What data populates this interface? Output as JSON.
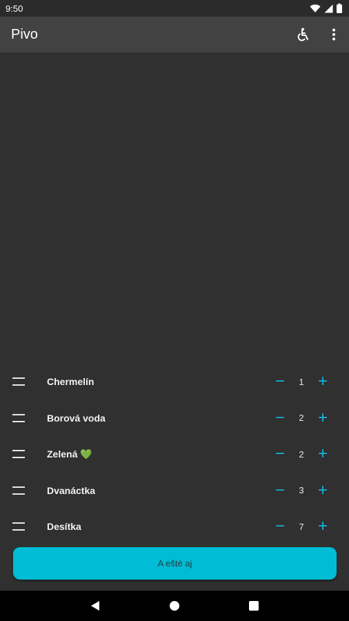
{
  "status_bar": {
    "time": "9:50"
  },
  "app_bar": {
    "title": "Pivo"
  },
  "beers": [
    {
      "name": "Chermelín",
      "count": "1"
    },
    {
      "name": "Borová voda",
      "count": "2"
    },
    {
      "name": "Zelená 💚",
      "count": "2"
    },
    {
      "name": "Dvanáctka",
      "count": "3"
    },
    {
      "name": "Desítka",
      "count": "7"
    }
  ],
  "controls": {
    "minus": "−",
    "plus": "+"
  },
  "main_button": {
    "label": "A ešté aj"
  },
  "colors": {
    "accent": "#19b4e0",
    "button": "#00bcd4",
    "background": "#303030",
    "appbar": "#424242"
  },
  "icons": [
    "wifi-icon",
    "signal-icon",
    "battery-icon",
    "accessibility-icon",
    "more-vert-icon",
    "drag-handle-icon",
    "back-icon",
    "home-icon",
    "recents-icon"
  ]
}
